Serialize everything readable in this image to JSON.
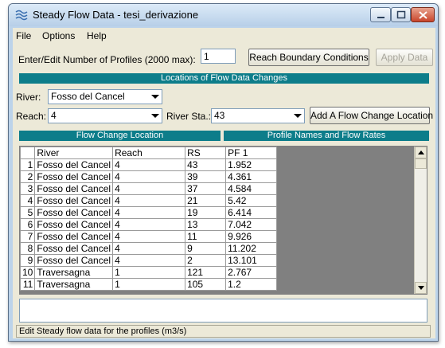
{
  "window": {
    "title": "Steady Flow Data - tesi_derivazione",
    "controls": [
      "minimize-icon",
      "maximize-icon",
      "close-icon"
    ]
  },
  "menu": [
    {
      "label": "File"
    },
    {
      "label": "Options"
    },
    {
      "label": "Help"
    }
  ],
  "profiles": {
    "label": "Enter/Edit Number of Profiles (2000 max):",
    "value": "1"
  },
  "buttons": {
    "reach_boundary": "Reach Boundary Conditions",
    "apply_data": "Apply Data",
    "add_flow_change": "Add A Flow Change Location"
  },
  "locations": {
    "section_title": "Locations of Flow Data Changes",
    "river_label": "River:",
    "river_value": "Fosso del Cancel",
    "reach_label": "Reach:",
    "reach_value": "4",
    "river_sta_label": "River Sta.:",
    "river_sta_value": "43"
  },
  "table": {
    "left_section": "Flow Change Location",
    "right_section": "Profile Names and Flow Rates",
    "columns": [
      "River",
      "Reach",
      "RS",
      "PF 1"
    ],
    "rows": [
      {
        "n": "1",
        "river": "Fosso del Cancel",
        "reach": "4",
        "rs": "43",
        "pf1": "1.952"
      },
      {
        "n": "2",
        "river": "Fosso del Cancel",
        "reach": "4",
        "rs": "39",
        "pf1": "4.361"
      },
      {
        "n": "3",
        "river": "Fosso del Cancel",
        "reach": "4",
        "rs": "37",
        "pf1": "4.584"
      },
      {
        "n": "4",
        "river": "Fosso del Cancel",
        "reach": "4",
        "rs": "21",
        "pf1": "5.42"
      },
      {
        "n": "5",
        "river": "Fosso del Cancel",
        "reach": "4",
        "rs": "19",
        "pf1": "6.414"
      },
      {
        "n": "6",
        "river": "Fosso del Cancel",
        "reach": "4",
        "rs": "13",
        "pf1": "7.042"
      },
      {
        "n": "7",
        "river": "Fosso del Cancel",
        "reach": "4",
        "rs": "11",
        "pf1": "9.926"
      },
      {
        "n": "8",
        "river": "Fosso del Cancel",
        "reach": "4",
        "rs": "9",
        "pf1": "11.202"
      },
      {
        "n": "9",
        "river": "Fosso del Cancel",
        "reach": "4",
        "rs": "2",
        "pf1": "13.101"
      },
      {
        "n": "10",
        "river": "Traversagna",
        "reach": "1",
        "rs": "121",
        "pf1": "2.767"
      },
      {
        "n": "11",
        "river": "Traversagna",
        "reach": "1",
        "rs": "105",
        "pf1": "1.2"
      }
    ]
  },
  "status": {
    "text": "Edit Steady flow data for the profiles (m3/s)"
  },
  "colors": {
    "section_bar": "#0d7d8a",
    "window_face": "#ece9d8",
    "grid_empty": "#808080"
  }
}
